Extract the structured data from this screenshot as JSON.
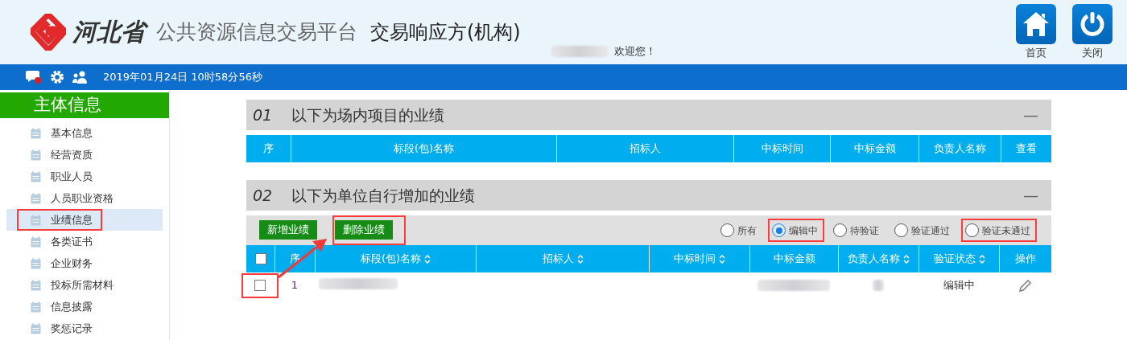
{
  "header": {
    "logo_text": "河北省",
    "platform": "公共资源信息交易平台",
    "role": "交易响应方(机构)",
    "welcome": "欢迎您！",
    "buttons": [
      {
        "kind": "home",
        "label": "首页"
      },
      {
        "kind": "power",
        "label": "关闭"
      }
    ]
  },
  "info_bar": {
    "datetime": "2019年01月24日 10时58分56秒"
  },
  "sidebar": {
    "title": "主体信息",
    "items": [
      {
        "label": "基本信息",
        "selected": false,
        "highlighted": false
      },
      {
        "label": "经营资质",
        "selected": false,
        "highlighted": false
      },
      {
        "label": "职业人员",
        "selected": false,
        "highlighted": false
      },
      {
        "label": "人员职业资格",
        "selected": false,
        "highlighted": false
      },
      {
        "label": "业绩信息",
        "selected": true,
        "highlighted": true
      },
      {
        "label": "各类证书",
        "selected": false,
        "highlighted": false
      },
      {
        "label": "企业财务",
        "selected": false,
        "highlighted": false
      },
      {
        "label": "投标所需材料",
        "selected": false,
        "highlighted": false
      },
      {
        "label": "信息披露",
        "selected": false,
        "highlighted": false
      },
      {
        "label": "奖惩记录",
        "selected": false,
        "highlighted": false
      }
    ]
  },
  "sections": [
    {
      "number": "01",
      "title": "以下为场内项目的业绩",
      "collapse": "—",
      "table": {
        "columns": [
          {
            "kind": "text",
            "label": "序",
            "sortable": false
          },
          {
            "kind": "text",
            "label": "标段(包)名称",
            "sortable": false
          },
          {
            "kind": "text",
            "label": "招标人",
            "sortable": false
          },
          {
            "kind": "text",
            "label": "中标时间",
            "sortable": false
          },
          {
            "kind": "text",
            "label": "中标金额",
            "sortable": false
          },
          {
            "kind": "text",
            "label": "负责人名称",
            "sortable": false
          },
          {
            "kind": "text",
            "label": "查看",
            "sortable": false
          }
        ]
      }
    },
    {
      "number": "02",
      "title": "以下为单位自行增加的业绩",
      "collapse": "—",
      "actions": [
        {
          "label": "新增业绩",
          "highlighted": false
        },
        {
          "label": "删除业绩",
          "highlighted": true
        }
      ],
      "filters": [
        {
          "label": "所有",
          "selected": false,
          "highlighted": false
        },
        {
          "label": "编辑中",
          "selected": true,
          "highlighted": true
        },
        {
          "label": "待验证",
          "selected": false,
          "highlighted": false
        },
        {
          "label": "验证通过",
          "selected": false,
          "highlighted": false
        },
        {
          "label": "验证未通过",
          "selected": false,
          "highlighted": true
        }
      ],
      "table": {
        "columns": [
          {
            "kind": "checkbox",
            "checked": false
          },
          {
            "kind": "text",
            "label": "序",
            "sortable": false
          },
          {
            "kind": "text",
            "label": "标段(包)名称",
            "sortable": true
          },
          {
            "kind": "text",
            "label": "招标人",
            "sortable": true
          },
          {
            "kind": "text",
            "label": "中标时间",
            "sortable": true
          },
          {
            "kind": "text",
            "label": "中标金额",
            "sortable": false
          },
          {
            "kind": "text",
            "label": "负责人名称",
            "sortable": true
          },
          {
            "kind": "text",
            "label": "验证状态",
            "sortable": true
          },
          {
            "kind": "text",
            "label": "操作",
            "sortable": false
          }
        ],
        "rows": [
          {
            "checked": false,
            "highlighted": true,
            "number": "1",
            "status": "编辑中"
          }
        ]
      }
    }
  ]
}
